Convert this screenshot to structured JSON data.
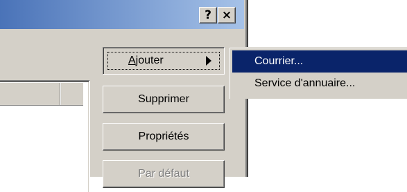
{
  "window": {
    "help_label": "?",
    "close_label": "×"
  },
  "buttons": {
    "add_prefix": "A",
    "add_rest": "jouter",
    "delete": "Supprimer",
    "properties": "Propriétés",
    "set_default": "Par défaut"
  },
  "submenu": {
    "items": [
      {
        "label": "Courrier..."
      },
      {
        "label": "Service d'annuaire..."
      }
    ]
  },
  "colors": {
    "titlebar_start": "#4a73b8",
    "titlebar_end": "#a6c2e8",
    "menu_highlight": "#0a246a",
    "face": "#d4d0c8"
  }
}
